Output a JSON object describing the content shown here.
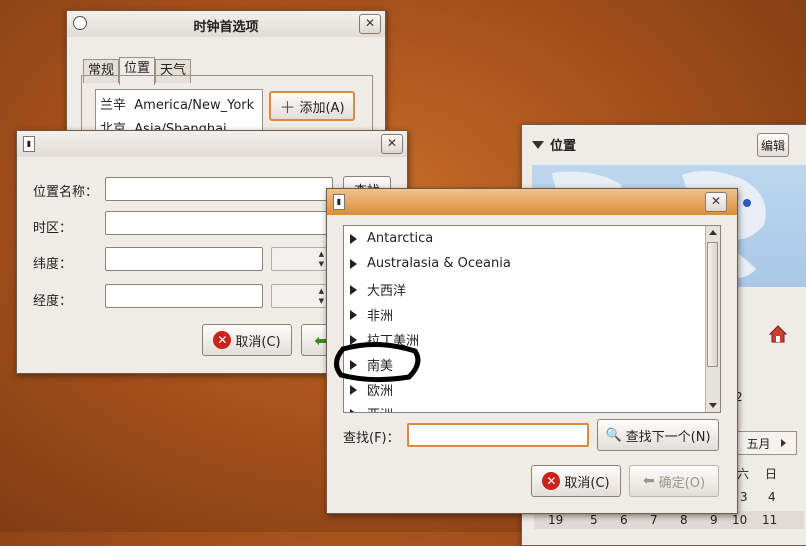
{
  "prefs_window": {
    "title": "时钟首选项",
    "tabs": [
      "常规",
      "位置",
      "天气"
    ],
    "locations": [
      {
        "city": "兰辛",
        "tz": "America/New_York"
      },
      {
        "city": "北京",
        "tz": "Asia/Shanghai"
      }
    ],
    "add_button": "添加(A)"
  },
  "edit_location_window": {
    "fields": {
      "name_label": "位置名称：",
      "timezone_label": "时区：",
      "latitude_label": "纬度：",
      "longitude_label": "经度："
    },
    "find_button": "查找",
    "cancel_button": "取消(C)"
  },
  "calendar_panel": {
    "header": "位置",
    "edit_button": "编辑",
    "month": "五月",
    "weekdays": [
      "六",
      "日"
    ],
    "week_row_1": [
      "2"
    ],
    "week_row_2": [
      "3",
      "4"
    ],
    "week_row_3": [
      "19",
      "5",
      "6",
      "7",
      "8",
      "9",
      "10",
      "11"
    ]
  },
  "timezone_dialog": {
    "regions": [
      "Antarctica",
      "Australasia & Oceania",
      "大西洋",
      "非洲",
      "拉丁美洲",
      "南美",
      "欧洲",
      "亚洲"
    ],
    "search_label": "查找(F)：",
    "search_value": "",
    "find_next_button": "查找下一个(N)",
    "cancel_button": "取消(C)",
    "ok_button": "确定(O)"
  }
}
